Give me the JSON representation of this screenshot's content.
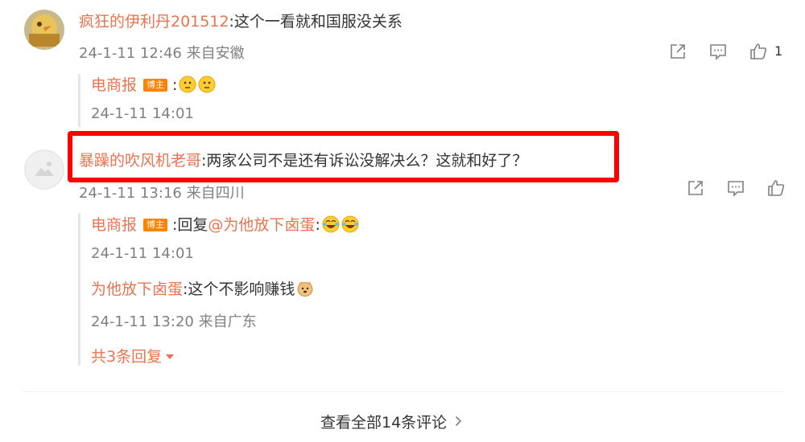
{
  "comments": [
    {
      "user": "疯狂的伊利丹201512",
      "text": ":这个一看就和国服没关系",
      "meta": "24-1-11 12:46 来自安徽",
      "like_count": "1",
      "replies": [
        {
          "user": "电商报",
          "badge": "博主",
          "text": ":",
          "meta": "24-1-11 14:01"
        }
      ]
    },
    {
      "user": "暴躁的吹风机老哥",
      "text": ":两家公司不是还有诉讼没解决么？这就和好了？",
      "meta": "24-1-11 13:16 来自四川",
      "replies": [
        {
          "user": "电商报",
          "badge": "博主",
          "text": ":回复",
          "mention": "@为他放下卤蛋",
          "text_after": ":",
          "meta": "24-1-11 14:01"
        },
        {
          "user": "为他放下卤蛋",
          "text": ":这个不影响赚钱",
          "meta": "24-1-11 13:20 来自广东"
        }
      ],
      "more_replies": "共3条回复"
    }
  ],
  "view_all": "查看全部14条评论",
  "colors": {
    "name": "#eb7350",
    "highlight": "#ff0000",
    "badge": "#ff8200"
  }
}
